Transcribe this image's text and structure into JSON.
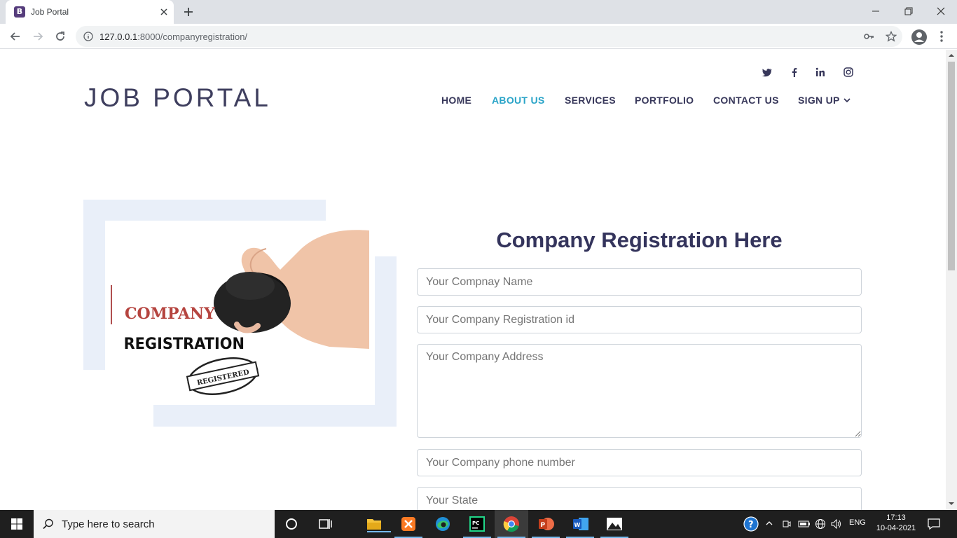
{
  "browser": {
    "tab_title": "Job Portal",
    "favicon_letter": "B",
    "url_host": "127.0.0.1",
    "url_rest": ":8000/companyregistration/"
  },
  "site": {
    "brand": "JOB PORTAL",
    "nav": [
      {
        "label": "HOME",
        "active": false
      },
      {
        "label": "ABOUT US",
        "active": true
      },
      {
        "label": "SERVICES",
        "active": false
      },
      {
        "label": "PORTFOLIO",
        "active": false
      },
      {
        "label": "CONTACT US",
        "active": false
      },
      {
        "label": "SIGN UP",
        "active": false
      }
    ],
    "social_icons": [
      "twitter-icon",
      "facebook-icon",
      "linkedin-icon",
      "instagram-icon"
    ],
    "accent_color": "#2aa4c8",
    "heading_color": "#34345c"
  },
  "hero_image": {
    "line1": "COMPANY",
    "line2": "REGISTRATION",
    "stamp_text": "REGISTERED"
  },
  "form": {
    "title": "Company Registration Here",
    "company_name_placeholder": "Your Compnay Name",
    "registration_id_placeholder": "Your Company Registration id",
    "address_placeholder": "Your Company Address",
    "phone_placeholder": "Your Company phone number",
    "state_placeholder": "Your State"
  },
  "taskbar": {
    "search_placeholder": "Type here to search",
    "language": "ENG",
    "time": "17:13",
    "date": "10-04-2021"
  }
}
